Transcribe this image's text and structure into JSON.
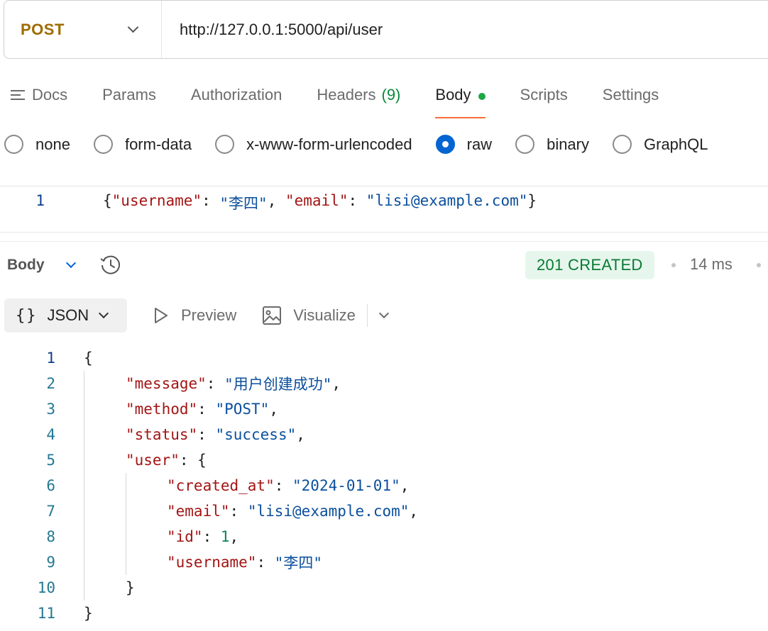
{
  "request": {
    "method": "POST",
    "url": "http://127.0.0.1:5000/api/user"
  },
  "tabs": {
    "docs": "Docs",
    "params": "Params",
    "authorization": "Authorization",
    "headers": "Headers",
    "headers_count": "(9)",
    "body": "Body",
    "scripts": "Scripts",
    "settings": "Settings"
  },
  "body_types": {
    "none": "none",
    "form_data": "form-data",
    "urlencoded": "x-www-form-urlencoded",
    "raw": "raw",
    "binary": "binary",
    "graphql": "GraphQL",
    "selected": "raw"
  },
  "request_editor": {
    "line_number": "1",
    "brace_open": "{",
    "k1": "\"username\"",
    "colon1": ": ",
    "v1": "\"李四\"",
    "comma1": ", ",
    "k2": "\"email\"",
    "colon2": ": ",
    "v2": "\"lisi@example.com\"",
    "brace_close": "}"
  },
  "response": {
    "section_label": "Body",
    "status": "201 CREATED",
    "time": "14 ms",
    "format": "JSON",
    "preview": "Preview",
    "visualize": "Visualize",
    "lines": {
      "ln1": "1",
      "ln2": "2",
      "ln3": "3",
      "ln4": "4",
      "ln5": "5",
      "ln6": "6",
      "ln7": "7",
      "ln8": "8",
      "ln9": "9",
      "ln10": "10",
      "ln11": "11"
    },
    "json": {
      "open": "{",
      "message_key": "\"message\"",
      "message_val": "\"用户创建成功\"",
      "method_key": "\"method\"",
      "method_val": "\"POST\"",
      "status_key": "\"status\"",
      "status_val": "\"success\"",
      "user_key": "\"user\"",
      "user_open": "{",
      "created_key": "\"created_at\"",
      "created_val": "\"2024-01-01\"",
      "email_key": "\"email\"",
      "email_val": "\"lisi@example.com\"",
      "id_key": "\"id\"",
      "id_val": "1",
      "username_key": "\"username\"",
      "username_val": "\"李四\"",
      "user_close": "}",
      "close": "}"
    }
  },
  "colors": {
    "method": "#a06b00",
    "active_tab_underline": "#ff6c37",
    "status_bg": "#e6f6ec",
    "status_text": "#0a7a34",
    "json_key": "#a31515",
    "json_string": "#0b4f9c",
    "json_number": "#098658",
    "radio_selected": "#0265d2"
  },
  "icons": {
    "method_dropdown": "chevron-down-icon",
    "docs": "docs-lines-icon",
    "body_dot": "green-dot-icon",
    "history": "history-icon",
    "format": "braces-icon",
    "preview": "play-icon",
    "visualize": "image-icon"
  }
}
